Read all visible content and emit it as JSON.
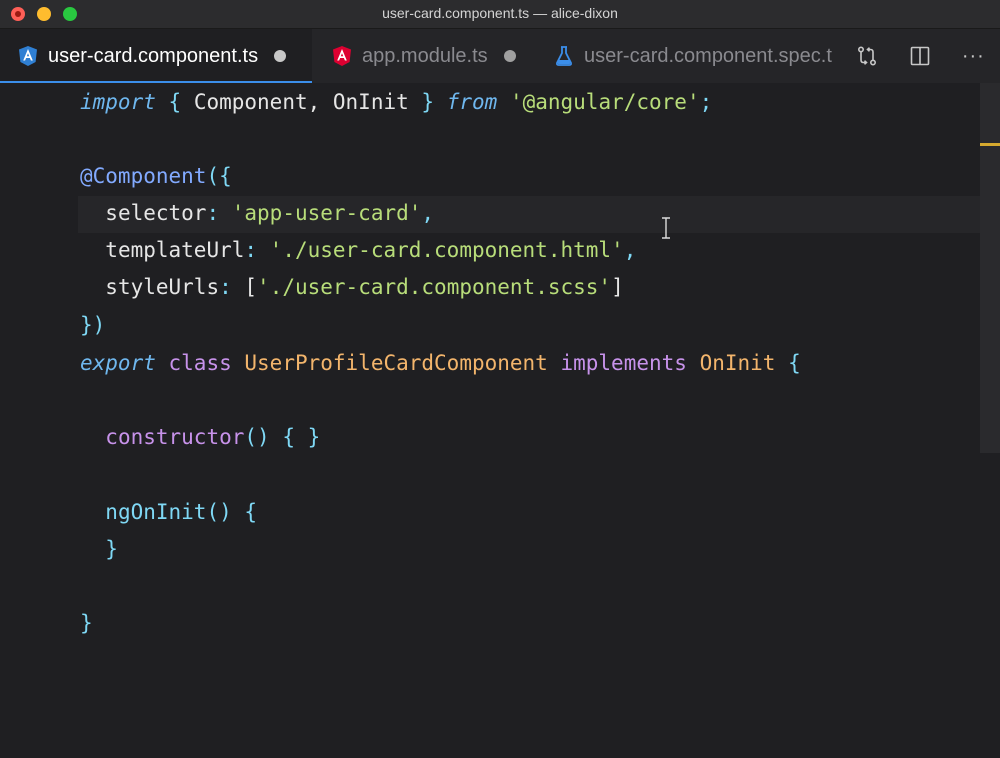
{
  "window": {
    "title": "user-card.component.ts — alice-dixon"
  },
  "tabs": [
    {
      "label": "user-card.component.ts",
      "icon": "angular-a-icon",
      "active": true,
      "dirty": true
    },
    {
      "label": "app.module.ts",
      "icon": "angular-shield-icon",
      "active": false,
      "dirty": true
    },
    {
      "label": "user-card.component.spec.t",
      "icon": "flask-icon",
      "active": false,
      "dirty": false
    }
  ],
  "tab_actions": [
    {
      "name": "source-control-compare-icon"
    },
    {
      "name": "split-editor-icon"
    },
    {
      "name": "more-actions-icon",
      "label": "···"
    }
  ],
  "code": {
    "line1": {
      "kw_import": "import",
      "brace_open": "{",
      "names": " Component, OnInit ",
      "brace_close": "}",
      "kw_from": "from",
      "module": "'@angular/core'",
      "semi": ";"
    },
    "line3": {
      "decorator": "@Component",
      "paren": "({"
    },
    "line4": {
      "key": "selector",
      "colon": ": ",
      "value": "'app-user-card'",
      "comma": ","
    },
    "line5": {
      "key": "templateUrl",
      "colon": ": ",
      "value": "'./user-card.component.html'",
      "comma": ","
    },
    "line6": {
      "key": "styleUrls",
      "colon": ": ",
      "bracket_open": "[",
      "value": "'./user-card.component.scss'",
      "bracket_close": "]"
    },
    "line7": {
      "text": "})"
    },
    "line8": {
      "kw_export": "export",
      "kw_class": "class",
      "class_name": "UserProfileCardComponent",
      "kw_implements": "implements",
      "iface": "OnInit",
      "brace": "{"
    },
    "line10": {
      "name": "constructor",
      "parens": "()",
      "body": "{ }"
    },
    "line12": {
      "name": "ngOnInit",
      "parens": "()",
      "brace": "{"
    },
    "line13": {
      "brace": "}"
    },
    "line15": {
      "brace": "}"
    }
  },
  "colors": {
    "accent": "#3b8eea",
    "scroll_marker": "#d6a92f",
    "angular_red": "#dd0031",
    "angular_blue": "#2f7fd3"
  }
}
